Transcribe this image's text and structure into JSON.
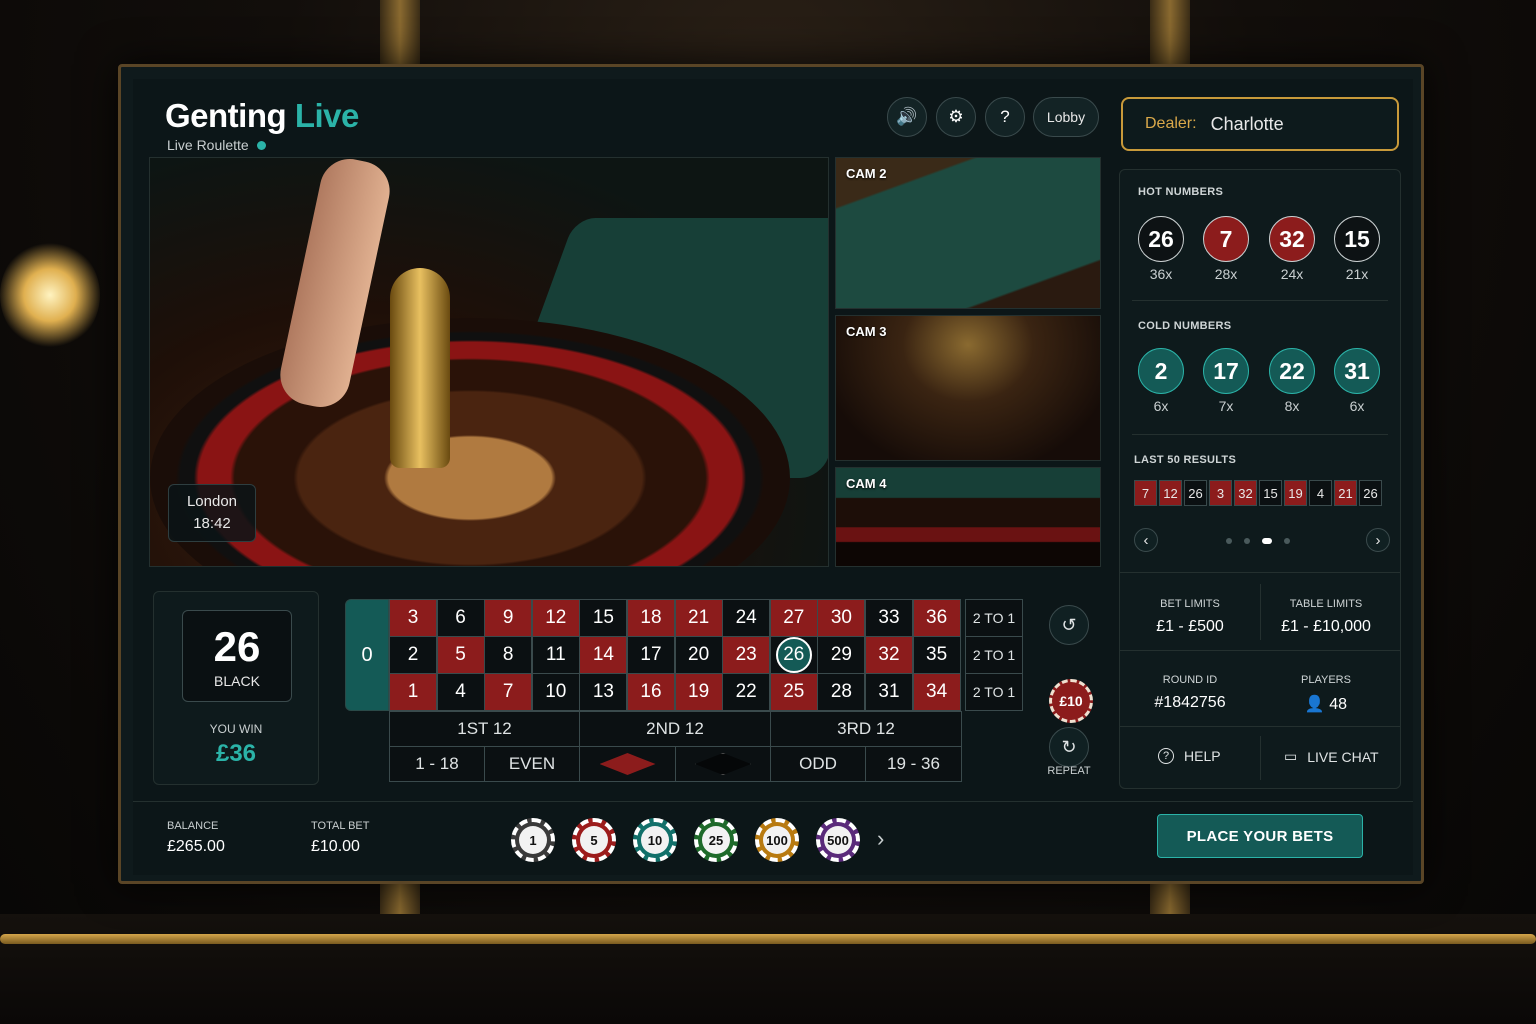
{
  "brand": {
    "name_a": "Genting",
    "name_b": "Live",
    "subtitle": "Live Roulette"
  },
  "toolbar": {
    "sound_icon": "speaker-icon",
    "settings_icon": "gear-icon",
    "help_label": "?",
    "lobby_label": "Lobby"
  },
  "dealer": {
    "label": "Dealer:",
    "name": "Charlotte"
  },
  "video": {
    "location": "London",
    "time": "18:42",
    "cams": [
      "CAM 2",
      "CAM 3",
      "CAM 4"
    ]
  },
  "hot": {
    "title": "HOT NUMBERS",
    "items": [
      {
        "n": "26",
        "c": "36x"
      },
      {
        "n": "7",
        "c": "28x"
      },
      {
        "n": "32",
        "c": "24x"
      },
      {
        "n": "15",
        "c": "21x"
      }
    ]
  },
  "cold": {
    "title": "COLD NUMBERS",
    "items": [
      {
        "n": "2",
        "c": "6x"
      },
      {
        "n": "17",
        "c": "7x"
      },
      {
        "n": "22",
        "c": "8x"
      },
      {
        "n": "31",
        "c": "6x"
      }
    ]
  },
  "last": {
    "title": "LAST 50 RESULTS",
    "items": [
      "7",
      "12",
      "26",
      "3",
      "32",
      "15",
      "19",
      "4",
      "21",
      "26"
    ]
  },
  "limits": {
    "bet_label": "BET LIMITS",
    "bet_value": "£1 - £500",
    "table_label": "TABLE LIMITS",
    "table_value": "£1 - £10,000"
  },
  "round": {
    "id_label": "ROUND ID",
    "id_value": "#1842756",
    "players_label": "PLAYERS",
    "players_value": "48"
  },
  "actions": {
    "help": "HELP",
    "chat": "LIVE CHAT"
  },
  "result": {
    "number": "26",
    "color": "BLACK",
    "win_label": "YOU WIN",
    "win_amount": "£36"
  },
  "board": {
    "zero": "0",
    "rows": [
      [
        "3",
        "6",
        "9",
        "12",
        "15",
        "18",
        "21",
        "24",
        "27",
        "30",
        "33",
        "36"
      ],
      [
        "2",
        "5",
        "8",
        "11",
        "14",
        "17",
        "20",
        "23",
        "26",
        "29",
        "32",
        "35"
      ],
      [
        "1",
        "4",
        "7",
        "10",
        "13",
        "16",
        "19",
        "22",
        "25",
        "28",
        "31",
        "34"
      ]
    ],
    "columns": [
      "2 TO 1",
      "2 TO 1",
      "2 TO 1"
    ],
    "dozens": [
      "1ST 12",
      "2ND 12",
      "3RD 12"
    ],
    "outside": [
      "1 - 18",
      "EVEN",
      "ODD",
      "19 - 36"
    ],
    "selected": "26"
  },
  "controls": {
    "chip": "£10",
    "repeat": "REPEAT"
  },
  "footer": {
    "balance_label": "BALANCE",
    "balance": "£265.00",
    "bet_label": "TOTAL BET",
    "bet": "£10.00",
    "chips": [
      "1",
      "5",
      "10",
      "25",
      "100",
      "500"
    ],
    "place": "PLACE YOUR BETS"
  },
  "colors": {
    "accent": "#2bb3a8",
    "red": "#8c1c1c",
    "gold": "#c89a3a"
  }
}
